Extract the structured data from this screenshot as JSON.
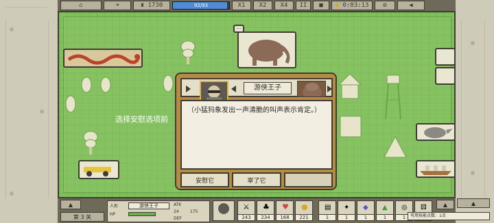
{
  "topbar": {
    "timer": "1730",
    "hp_text": "92/93",
    "hp_fraction": 0.96,
    "speed_1": "X1",
    "speed_2": "X2",
    "speed_4": "X4",
    "pause": "II",
    "clock": "0:03:13"
  },
  "field": {
    "hint": "选择安慰选项前"
  },
  "dialog": {
    "speaker_name": "游侠王子",
    "body_text": "（小猛犸象发出一声清脆的叫声表示肯定。）",
    "option_1": "安慰它",
    "option_2": "宰了它",
    "option_3": ""
  },
  "bottombar": {
    "level": "第 3 关",
    "unit_name": "游侠王子",
    "stats": [
      "243",
      "234",
      "168",
      "221"
    ],
    "atk": "24",
    "atk2": "175",
    "small_labels": [
      "人形",
      "HP",
      "ATK",
      "DEF"
    ],
    "counts": [
      "1",
      "1",
      "1",
      "1",
      "1",
      "1",
      "1",
      "1"
    ],
    "status_note": "可用技能点数：1点"
  },
  "colors": {
    "grass": "#7fbf5c",
    "frame": "#cfcbb9",
    "dialog_wood": "#b58c42",
    "accent_gold": "#e0b33b"
  }
}
